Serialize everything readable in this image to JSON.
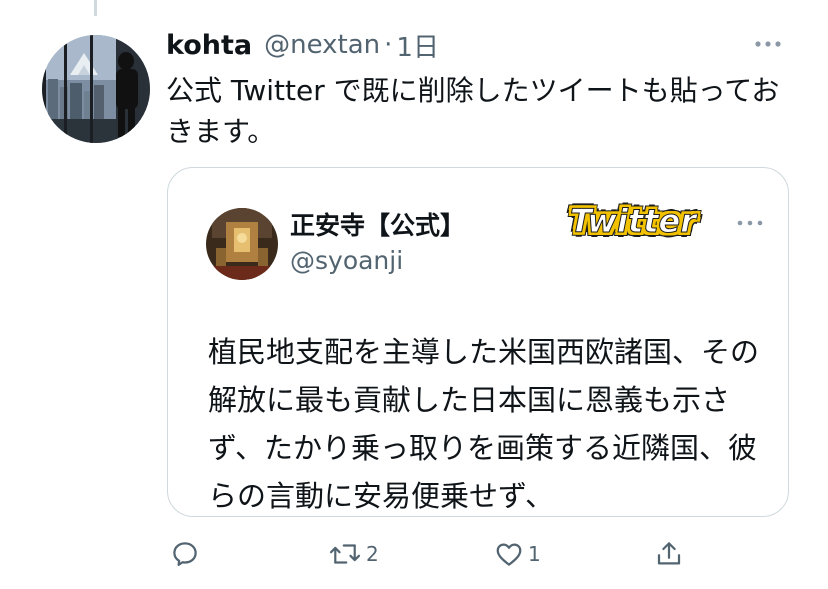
{
  "tweet": {
    "display_name": "kohta",
    "handle": "@nextan",
    "separator": "·",
    "time": "1日",
    "text": "公式 Twitter で既に削除したツイートも貼っておきます。",
    "more_icon": "more-icon"
  },
  "quote": {
    "display_name": "正安寺【公式】",
    "handle": "@syoanji",
    "stamp_label": "Twitter",
    "stamp_color": "#f2c200",
    "body": "植民地支配を主導した米国西欧諸国、その解放に最も貢献した日本国に恩義も示さず、たかり乗っ取りを画策する近隣国、彼らの言動に安易便乗せず、",
    "more_icon": "more-icon"
  },
  "actions": {
    "reply": {
      "icon": "reply-icon",
      "count": ""
    },
    "retweet": {
      "icon": "retweet-icon",
      "count": "2"
    },
    "like": {
      "icon": "heart-icon",
      "count": "1"
    },
    "share": {
      "icon": "share-icon",
      "count": ""
    }
  },
  "colors": {
    "text_primary": "#0f1419",
    "text_secondary": "#536471",
    "border": "#cfd9de"
  }
}
